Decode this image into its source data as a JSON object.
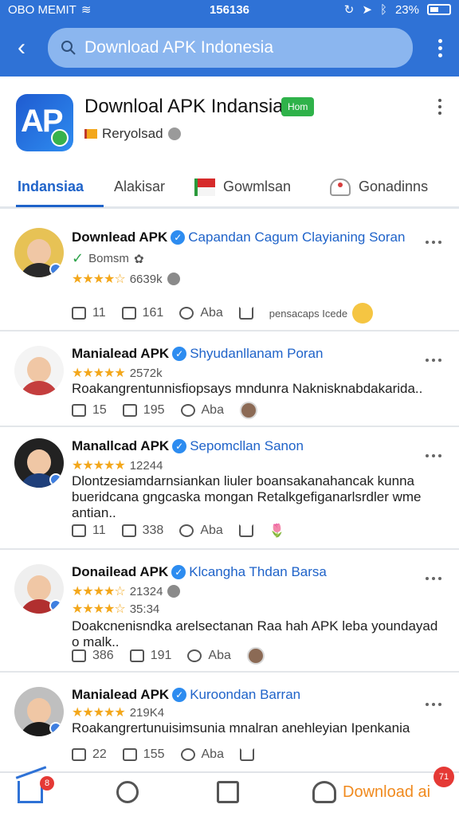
{
  "status_bar": {
    "carrier": "OBO MEMIT",
    "time": "156136",
    "battery": "23%"
  },
  "app_bar": {
    "search_value": "Download APK Indonesia"
  },
  "app_header": {
    "title": "Downloal APK Indansia",
    "tag": "Hom",
    "developer": "Reryolsad"
  },
  "tabs": [
    {
      "label": "Indansiaa",
      "active": true
    },
    {
      "label": "Alakisar"
    },
    {
      "label": "Gowmlsan"
    },
    {
      "label": "Gonadinns"
    }
  ],
  "posts": [
    {
      "author": "Downlead APK",
      "handle": "Capandan Cagum Clayianing Soran",
      "subtitle": "Bomsm",
      "rating_count": "6639k",
      "actions": {
        "replies": "11",
        "reposts": "161",
        "likes": "Aba"
      },
      "extra": "pensacaps Icede"
    },
    {
      "author": "Manialead APK",
      "handle": "Shyudanllanam Poran",
      "rating_count": "2572k",
      "text": "Roakangrentunnisfiopsays mndunra Naknisknabdakarida..",
      "actions": {
        "replies": "15",
        "reposts": "195",
        "likes": "Aba"
      }
    },
    {
      "author": "Manallcad APK",
      "handle": "Sepomcllan Sanon",
      "rating_count": "12244",
      "text": "Dlontzesiamdarnsiankan liuler boansakanahancak kunna bueridcana gngcaska mongan Retalkgefiganarlsrdler wme antian..",
      "actions": {
        "replies": "11",
        "reposts": "338",
        "likes": "Aba"
      }
    },
    {
      "author": "Donailead APK",
      "handle": "Klcangha Thdan Barsa",
      "rating_count": "21324",
      "rating_count2": "35:34",
      "text": "Doakcnenisndka arelsectanan Raa hah APK leba youndayad o malk..",
      "actions": {
        "replies": "386",
        "reposts": "191",
        "likes": "Aba"
      }
    },
    {
      "author": "Manialead APK",
      "handle": "Kuroondan Barran",
      "rating_count": "219K4",
      "text": "Roakangrertunuisimsunia mnalran anehleyian Ipenkania",
      "actions": {
        "replies": "22",
        "reposts": "155",
        "likes": "Aba"
      }
    }
  ],
  "bottom_nav": {
    "home_badge": "8",
    "download_label": "Download ai",
    "download_badge": "71"
  },
  "colors": {
    "primary": "#2f72d6",
    "accent": "#1f63c9",
    "star": "#f3a71b",
    "tag": "#2fb24a",
    "badge": "#e53935"
  }
}
